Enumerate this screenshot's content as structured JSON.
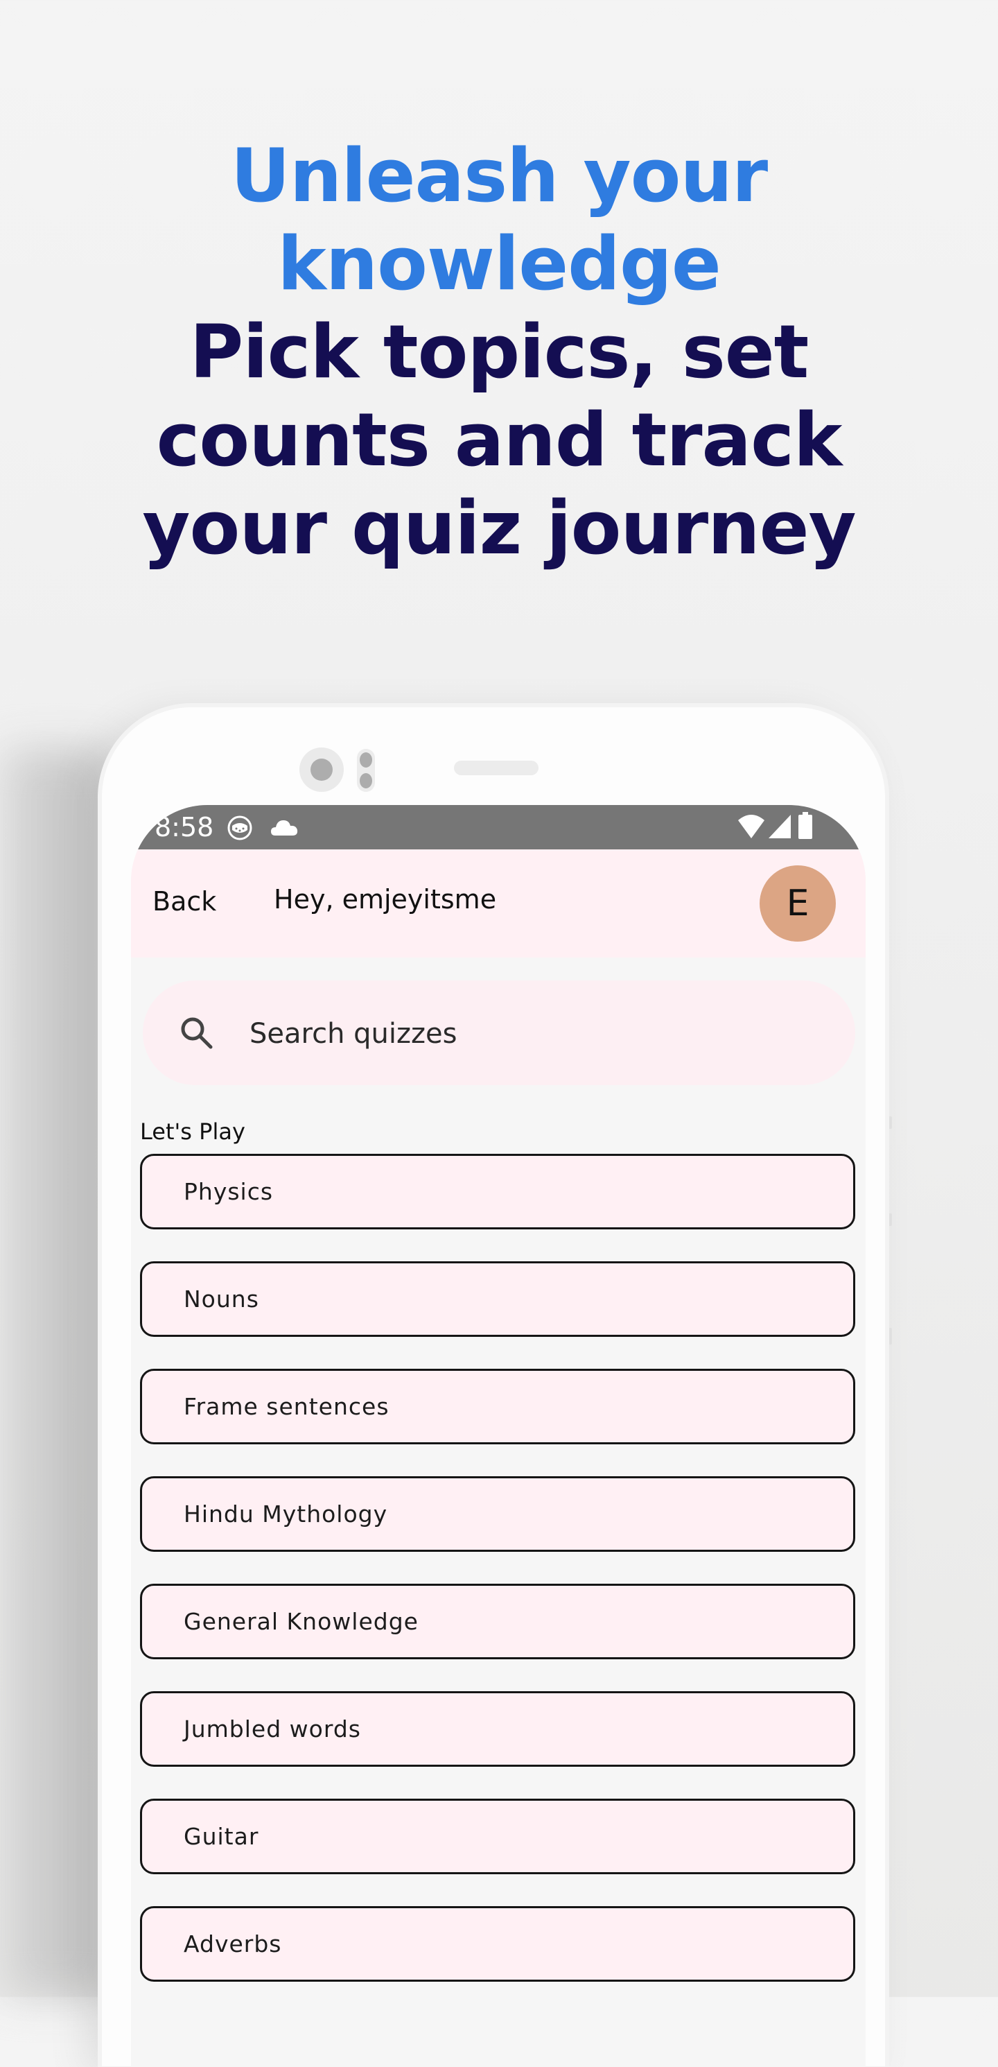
{
  "headline": {
    "accent_lines": [
      "Unleash your",
      "knowledge"
    ],
    "main_lines": [
      "Pick topics, set",
      "counts and track",
      "your quiz journey"
    ],
    "accent_color": "#2f7ce0",
    "main_color": "#140e52"
  },
  "status_bar": {
    "time": "8:58",
    "left_icons": [
      "app-notification-icon",
      "cloud-icon"
    ],
    "right_icons": [
      "wifi-icon",
      "cellular-signal-icon",
      "battery-icon"
    ]
  },
  "app_bar": {
    "back_label": "Back",
    "greeting": "Hey, emjeyitsme",
    "avatar_initial": "E",
    "avatar_color": "#dca584"
  },
  "search": {
    "placeholder": "Search quizzes",
    "value": ""
  },
  "section": {
    "title": "Let's Play"
  },
  "quizzes": [
    {
      "label": "Physics"
    },
    {
      "label": "Nouns"
    },
    {
      "label": "Frame sentences"
    },
    {
      "label": "Hindu Mythology"
    },
    {
      "label": "General Knowledge"
    },
    {
      "label": "Jumbled words"
    },
    {
      "label": "Guitar"
    },
    {
      "label": "Adverbs"
    }
  ]
}
